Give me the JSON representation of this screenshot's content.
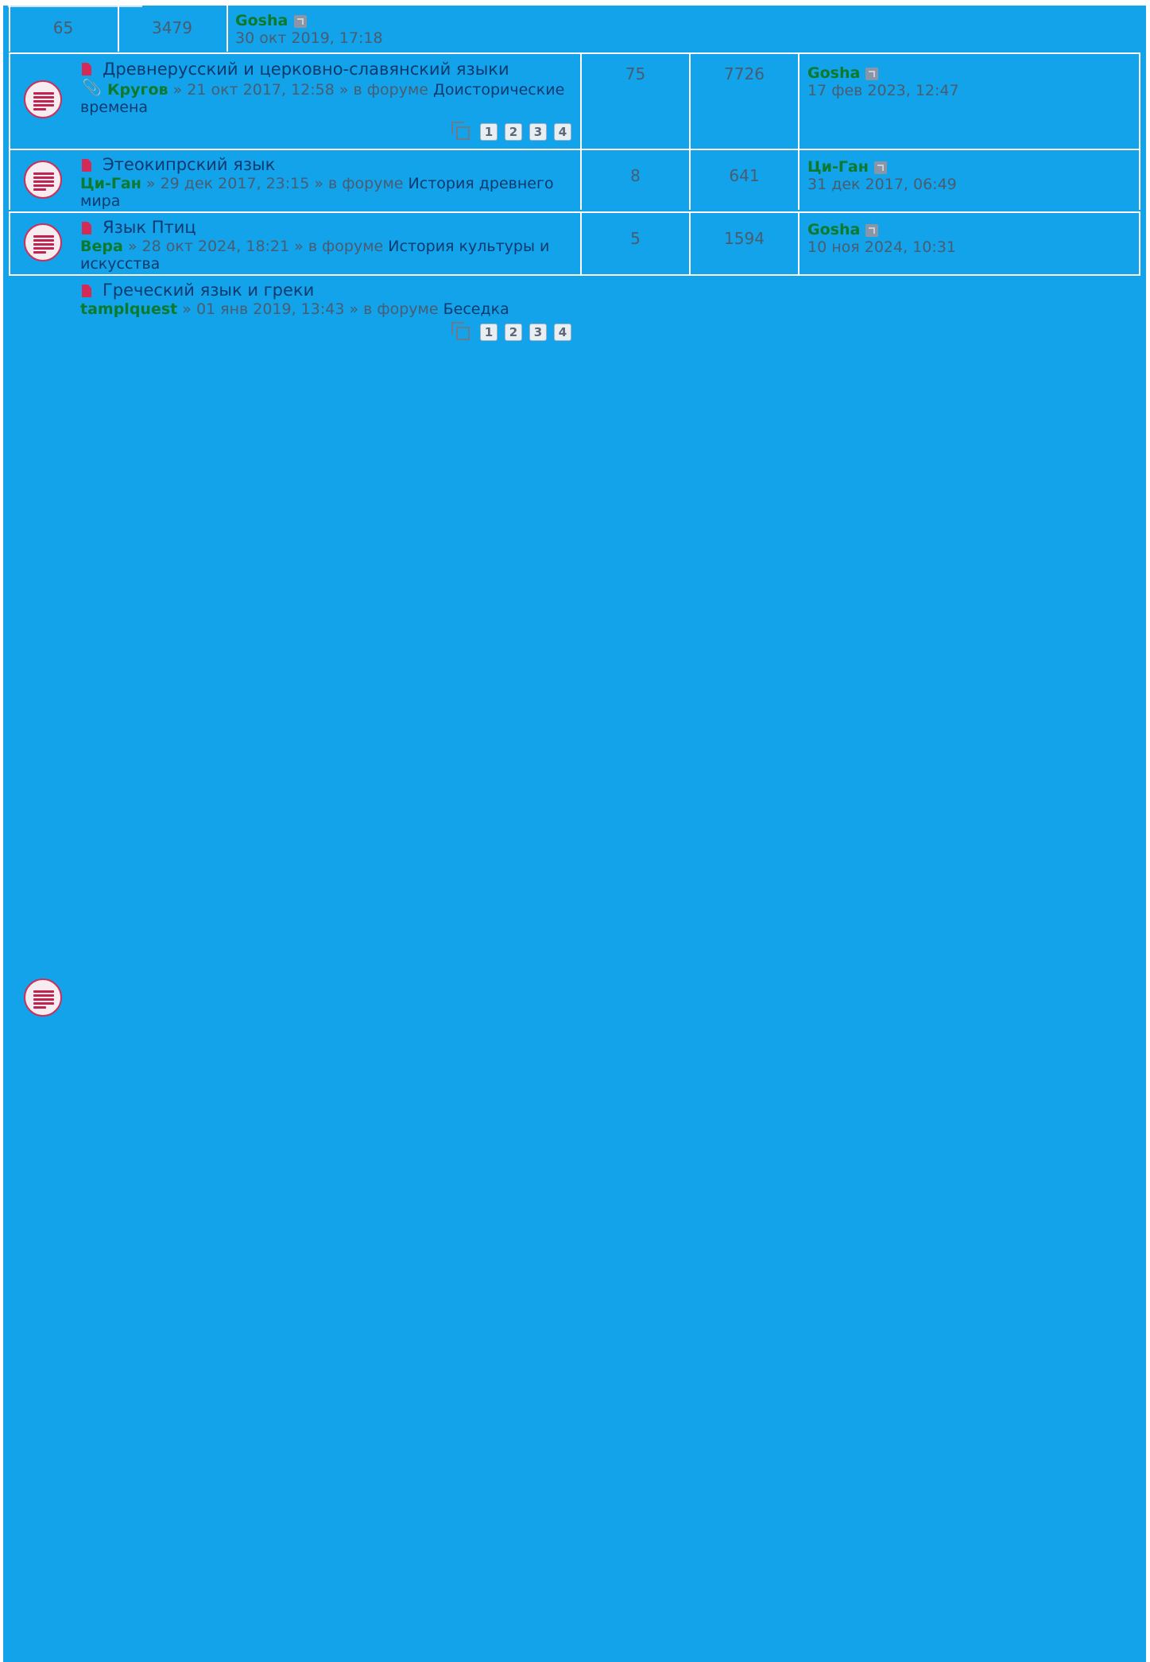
{
  "rows": [
    {
      "replies": "65",
      "views": "3479",
      "last_post": {
        "author": "Gosha",
        "date": "30 окт 2019, 17:18"
      }
    },
    {
      "title": "Древнерусский и церковно-славянский языки",
      "attachment_icon": "paperclip-icon",
      "author": "Кругов",
      "posted": " » 21 окт 2017, 12:58 » в форуме ",
      "forum": "Доисторические времена",
      "pages": [
        "1",
        "2",
        "3",
        "4"
      ],
      "replies": "75",
      "views": "7726",
      "last_post": {
        "author": "Gosha",
        "date": "17 фев 2023, 12:47"
      }
    },
    {
      "title": "Этеокипрский язык",
      "author": "Ци-Ган",
      "posted": " » 29 дек 2017, 23:15 » в форуме ",
      "forum": "История древнего мира",
      "replies": "8",
      "views": "641",
      "last_post": {
        "author": "Ци-Ган",
        "date": "31 дек 2017, 06:49"
      }
    },
    {
      "title": "Язык Птиц",
      "author": "Вера",
      "posted": " » 28 окт 2024, 18:21 » в форуме ",
      "forum": "История культуры и искусства",
      "replies": "5",
      "views": "1594",
      "last_post": {
        "author": "Gosha",
        "date": "10 ноя 2024, 10:31"
      }
    },
    {
      "title": "Греческий язык и греки",
      "author": "tamplquest",
      "posted": " » 01 янв 2019, 13:43 » в форуме ",
      "forum": "Беседка",
      "pages": [
        "1",
        "2",
        "3",
        "4"
      ]
    }
  ],
  "colors": {
    "background": "#13a3ea",
    "topic_title": "#0c3a6e",
    "username": "#0c7a2c",
    "meta_text": "#4a5c70",
    "unread_icon": "#cc2f58"
  }
}
